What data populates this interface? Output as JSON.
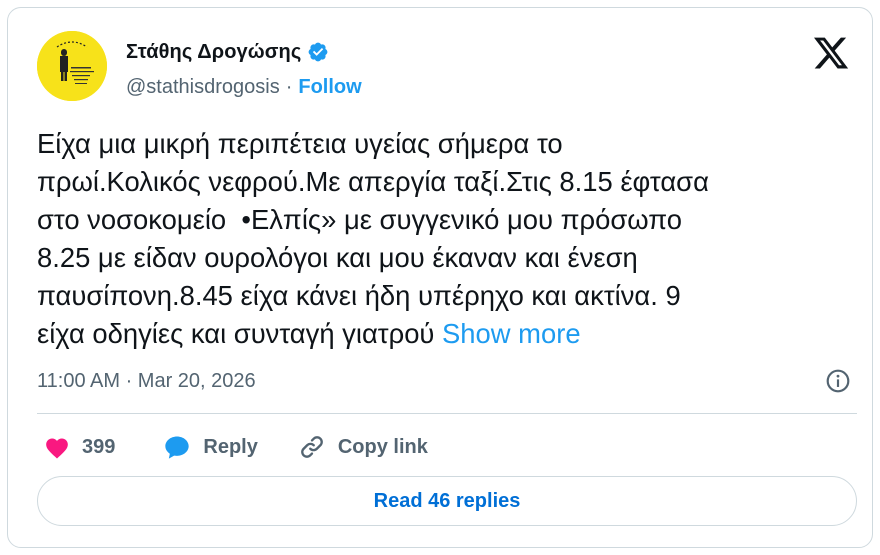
{
  "author": {
    "display_name": "Στάθης Δρογώσης",
    "handle": "@stathisdrogosis",
    "separator": "·",
    "follow_label": "Follow",
    "verified": true
  },
  "tweet": {
    "lines": [
      "Είχα μια μικρή περιπέτεια υγείας σήμερα το",
      "πρωί.Κολικός νεφρού.Με απεργία ταξί.Στις 8.15 έφτασα",
      "στο νοσοκομείο  •Ελπίς» με συγγενικό μου πρόσωπο",
      "8.25 με είδαν ουρολόγοι και μου έκαναν και ένεση",
      "παυσίπονη.8.45 είχα κάνει ήδη υπέρηχο και ακτίνα. 9",
      "είχα οδηγίες και συνταγή γιατρού "
    ],
    "show_more": "Show more",
    "timestamp": "11:00 AM · Mar 20, 2026"
  },
  "actions": {
    "likes": "399",
    "reply_label": "Reply",
    "copy_link_label": "Copy link"
  },
  "read_replies_label": "Read 46 replies",
  "icons": {
    "logo": "x-logo-icon",
    "verified": "verified-badge-icon",
    "info": "info-icon",
    "like": "heart-icon",
    "reply": "speech-bubble-icon",
    "link": "link-icon"
  },
  "colors": {
    "accent": "#1d9bf0",
    "like": "#f91880",
    "muted": "#536471",
    "text": "#0f1419",
    "border": "#cfd9de",
    "avatar_bg": "#f7e21a"
  }
}
